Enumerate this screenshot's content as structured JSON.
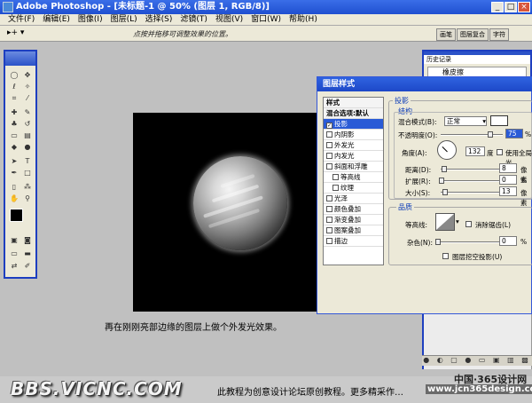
{
  "window": {
    "title": "Adobe Photoshop - [未标题-1 @ 50% (图层 1, RGB/8)]"
  },
  "menu": [
    "文件(F)",
    "编辑(E)",
    "图像(I)",
    "图层(L)",
    "选择(S)",
    "滤镜(T)",
    "视图(V)",
    "窗口(W)",
    "帮助(H)"
  ],
  "options": {
    "tool_symbol": "▸+ ▾",
    "hint": "点按并拖移可调整效果的位置。"
  },
  "panel_tabs": [
    "画笔",
    "图层复合",
    "字符"
  ],
  "history": {
    "tab": "历史记录",
    "item": "橡皮擦"
  },
  "dialog": {
    "title": "图层样式",
    "styles": [
      {
        "label": "样式",
        "checkbox": false,
        "checked": false,
        "selected": false,
        "header": true
      },
      {
        "label": "混合选项:默认",
        "checkbox": false,
        "checked": false,
        "selected": false,
        "header": true
      },
      {
        "label": "投影",
        "checkbox": true,
        "checked": true,
        "selected": true,
        "header": false
      },
      {
        "label": "内阴影",
        "checkbox": true,
        "checked": false,
        "selected": false,
        "header": false
      },
      {
        "label": "外发光",
        "checkbox": true,
        "checked": false,
        "selected": false,
        "header": false
      },
      {
        "label": "内发光",
        "checkbox": true,
        "checked": false,
        "selected": false,
        "header": false
      },
      {
        "label": "斜面和浮雕",
        "checkbox": true,
        "checked": false,
        "selected": false,
        "header": false
      },
      {
        "label": "等高线",
        "checkbox": true,
        "checked": false,
        "selected": false,
        "header": false,
        "indent": true
      },
      {
        "label": "纹理",
        "checkbox": true,
        "checked": false,
        "selected": false,
        "header": false,
        "indent": true
      },
      {
        "label": "光泽",
        "checkbox": true,
        "checked": false,
        "selected": false,
        "header": false
      },
      {
        "label": "颜色叠加",
        "checkbox": true,
        "checked": false,
        "selected": false,
        "header": false
      },
      {
        "label": "渐变叠加",
        "checkbox": true,
        "checked": false,
        "selected": false,
        "header": false
      },
      {
        "label": "图案叠加",
        "checkbox": true,
        "checked": false,
        "selected": false,
        "header": false
      },
      {
        "label": "描边",
        "checkbox": true,
        "checked": false,
        "selected": false,
        "header": false
      }
    ],
    "shadow": {
      "section": "投影",
      "structure": "结构",
      "blend_label": "混合模式(B):",
      "blend_value": "正常",
      "opacity_label": "不透明度(O):",
      "opacity_value": "75",
      "percent": "%",
      "angle_label": "角度(A):",
      "angle_value": "132",
      "degree": "度",
      "global_light": "使用全局光",
      "distance_label": "距离(D):",
      "distance_value": "8",
      "spread_label": "扩展(R):",
      "spread_value": "0",
      "size_label": "大小(S):",
      "size_value": "13",
      "px": "像素"
    },
    "quality": {
      "section": "品质",
      "contour_label": "等高线:",
      "antialias": "消除锯齿(L)",
      "noise_label": "杂色(N):",
      "noise_value": "0",
      "knockout": "图层挖空投影(U)"
    }
  },
  "caption": "再在刚刚亮部边缘的图层上做个外发光效果。",
  "footer": {
    "brand": "BBS.VICNC.COM",
    "text": "此教程为创意设计论坛原创教程。更多精采作…",
    "watermark_cn": "中国·365设计网",
    "watermark_url": "www.jcn365design.com"
  },
  "colors": {
    "titlebar": "#1f4fd0",
    "dialog_border": "#3558d8",
    "selection": "#2a5bd6"
  }
}
